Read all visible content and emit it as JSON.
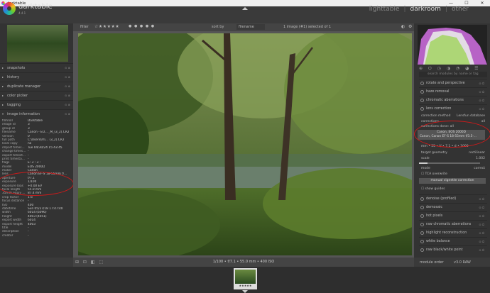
{
  "window": {
    "title": "darktable",
    "min": "—",
    "max": "☐",
    "close": "✕"
  },
  "header": {
    "app_name": "darktable",
    "version": "4.4.1",
    "views": {
      "lighttable": "lighttable",
      "darkroom": "darkroom",
      "other": "other"
    },
    "separator": "|"
  },
  "left_modules": [
    {
      "label": "snapshots"
    },
    {
      "label": "history"
    },
    {
      "label": "duplicate manager"
    },
    {
      "label": "color picker"
    },
    {
      "label": "tagging"
    },
    {
      "label": "image information"
    }
  ],
  "image_info": [
    {
      "k": "filmroll",
      "v": "Darktable"
    },
    {
      "k": "image id",
      "v": "3"
    },
    {
      "k": "group id",
      "v": "3"
    },
    {
      "k": "filename",
      "v": "Canon - EO... _M_(3_2).CR2"
    },
    {
      "k": "version",
      "v": "0"
    },
    {
      "k": "full path",
      "v": "C:\\Users\\m\\... (3_2).CR2"
    },
    {
      "k": "local copy",
      "v": "no"
    },
    {
      "k": "import times...",
      "v": "Tue 04/30/24 15:43:45"
    },
    {
      "k": "change times...",
      "v": "-"
    },
    {
      "k": "export timest...",
      "v": "-"
    },
    {
      "k": "print timesta...",
      "v": "-"
    },
    {
      "k": "flags",
      "v": "E: 3 : 3 :"
    },
    {
      "k": "model",
      "v": "EOS 2000D"
    },
    {
      "k": "maker",
      "v": "Canon"
    },
    {
      "k": "lens",
      "v": "Canon EF-S 18-55mm f/..."
    },
    {
      "k": "aperture",
      "v": "f/7.1"
    },
    {
      "k": "exposure",
      "v": "1/100"
    },
    {
      "k": "exposure bias",
      "v": "+0.00 EV"
    },
    {
      "k": "focal length",
      "v": "55.0 mm"
    },
    {
      "k": "35mm equiv ...",
      "v": "87.4 mm"
    },
    {
      "k": "crop factor",
      "v": "1.6"
    },
    {
      "k": "focus distance",
      "v": "-"
    },
    {
      "k": "ISO",
      "v": "400"
    },
    {
      "k": "datetime",
      "v": "Sun 05/27/18 17:47:40"
    },
    {
      "k": "width",
      "v": "6014 (6096)"
    },
    {
      "k": "height",
      "v": "4003 (4051)"
    },
    {
      "k": "export width",
      "v": "6014"
    },
    {
      "k": "export height",
      "v": "4003"
    },
    {
      "k": "title",
      "v": "-"
    },
    {
      "k": "description",
      "v": "-"
    },
    {
      "k": "creator",
      "v": "-"
    }
  ],
  "toolbar": {
    "filter_label": "filter",
    "stars": "☆★★★★★",
    "color_labels": "● ● ● ● ●",
    "sort_by": "sort by",
    "sort_field": "filename",
    "image_count": "1 image (#1) selected of 1",
    "icon1": "◐",
    "icon2": "⚙"
  },
  "status": {
    "exif_line": "1/100 • f/7.1 • 55.0 mm • 400 ISO",
    "bottom_icons": "⊞ ⊡ ◧ ⬚"
  },
  "right": {
    "search_placeholder": "search modules by name or tag",
    "module_buttons": "⊕ ⏻ ◷ ◑ ◔ ◕ ☰",
    "modules_top": [
      {
        "label": "rotate and perspective"
      },
      {
        "label": "haze removal"
      },
      {
        "label": "chromatic aberrations"
      },
      {
        "label": "lens correction"
      }
    ],
    "lens": {
      "correction_method_k": "correction method",
      "correction_method_v": "Lensfun database",
      "corrections_k": "corrections",
      "corrections_v": "all",
      "corrections_done_k": "corrections done: all",
      "corrections_done_v": "",
      "camera": "Canon, EOS 2000D",
      "lens_name": "Canon, Canon EF-S 18-55mm f/3.5-...",
      "params": "mm • 55 • f/ • 7.1 • d • 1000",
      "target_geometry_k": "target geometry",
      "target_geometry_v": "rectilinear",
      "scale_k": "scale",
      "scale_v": "1.002",
      "mode_k": "mode",
      "mode_v": "correct",
      "tca_overwrite": "TCA overwrite",
      "manual_vignette": "manual vignette correction"
    },
    "show_guides": "show guides",
    "modules_bottom": [
      {
        "label": "denoise (profiled)"
      },
      {
        "label": "demosaic"
      },
      {
        "label": "hot pixels"
      },
      {
        "label": "raw chromatic aberrations"
      },
      {
        "label": "highlight reconstruction"
      },
      {
        "label": "white balance"
      },
      {
        "label": "raw black/white point"
      }
    ],
    "footer": {
      "module_order_label": "module order",
      "module_order_value": "v3.0 RAW"
    }
  },
  "filmstrip": {
    "thumb_stars": "★★★★★"
  }
}
